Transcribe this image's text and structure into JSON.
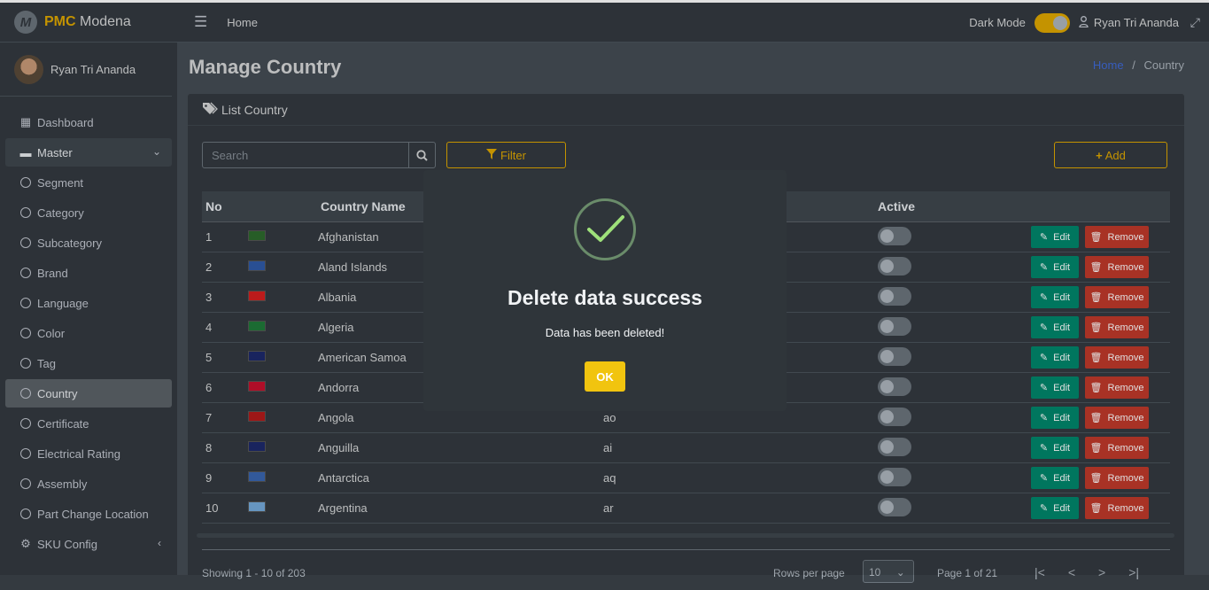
{
  "brand": {
    "logo_letter": "M",
    "strong": "PMC",
    "rest": " Modena"
  },
  "user": {
    "name": "Ryan Tri Ananda"
  },
  "sidebar": {
    "items": [
      {
        "label": "Dashboard",
        "icon": "grid-icon"
      },
      {
        "label": "Master",
        "icon": "hdd-icon"
      },
      {
        "label": "Segment"
      },
      {
        "label": "Category"
      },
      {
        "label": "Subcategory"
      },
      {
        "label": "Brand"
      },
      {
        "label": "Language"
      },
      {
        "label": "Color"
      },
      {
        "label": "Tag"
      },
      {
        "label": "Country"
      },
      {
        "label": "Certificate"
      },
      {
        "label": "Electrical Rating"
      },
      {
        "label": "Assembly"
      },
      {
        "label": "Part Change Location"
      },
      {
        "label": "SKU Config",
        "icon": "gear-icon"
      }
    ]
  },
  "navbar": {
    "home": "Home",
    "dark_mode": "Dark Mode",
    "user": "Ryan Tri Ananda"
  },
  "page": {
    "title": "Manage Country",
    "breadcrumb_home": "Home",
    "breadcrumb_sep": "/",
    "breadcrumb_current": "Country"
  },
  "card": {
    "title": "List Country",
    "search_placeholder": "Search",
    "filter_label": "Filter",
    "add_label": "Add"
  },
  "table": {
    "headers": {
      "no": "No",
      "name": "Country Name",
      "active": "Active"
    },
    "edit_label": "Edit",
    "remove_label": "Remove",
    "rows": [
      {
        "no": "1",
        "name": "Afghanistan",
        "code": "",
        "flag": "#2d6a2d"
      },
      {
        "no": "2",
        "name": "Aland Islands",
        "code": "",
        "flag": "#2f5aa8"
      },
      {
        "no": "3",
        "name": "Albania",
        "code": "",
        "flag": "#d61f1f"
      },
      {
        "no": "4",
        "name": "Algeria",
        "code": "",
        "flag": "#1f7a3a"
      },
      {
        "no": "5",
        "name": "American Samoa",
        "code": "",
        "flag": "#1d2a6b"
      },
      {
        "no": "6",
        "name": "Andorra",
        "code": "",
        "flag": "#c8102e"
      },
      {
        "no": "7",
        "name": "Angola",
        "code": "ao",
        "flag": "#b31b1b"
      },
      {
        "no": "8",
        "name": "Anguilla",
        "code": "ai",
        "flag": "#1d2a6b"
      },
      {
        "no": "9",
        "name": "Antarctica",
        "code": "aq",
        "flag": "#3a66b0"
      },
      {
        "no": "10",
        "name": "Argentina",
        "code": "ar",
        "flag": "#75aadb"
      }
    ]
  },
  "footer": {
    "showing": "Showing 1 - 10 of 203",
    "rows_per_page": "Rows per page",
    "rows_value": "10",
    "page": "Page 1 of 21"
  },
  "modal": {
    "title": "Delete data success",
    "text": "Data has been deleted!",
    "ok": "OK"
  }
}
